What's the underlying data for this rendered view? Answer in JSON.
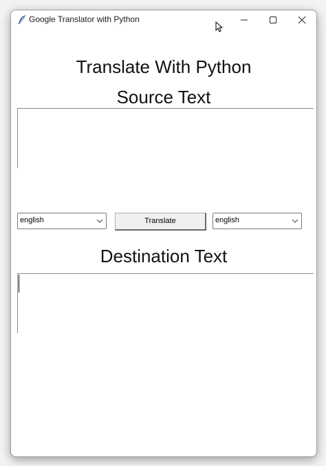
{
  "window": {
    "title": "Google Translator with Python",
    "controls": [
      "minimize-icon",
      "maximize-icon",
      "close-icon"
    ]
  },
  "app": {
    "title": "Translate With Python",
    "source_label": "Source Text",
    "destination_label": "Destination Text",
    "source_text": "",
    "destination_text": ""
  },
  "controls": {
    "source_language": "english",
    "destination_language": "english",
    "translate_label": "Translate"
  },
  "colors": {
    "window_bg": "#ffffff",
    "button_bg": "#f0f0f0",
    "border": "#7a7a7a"
  }
}
